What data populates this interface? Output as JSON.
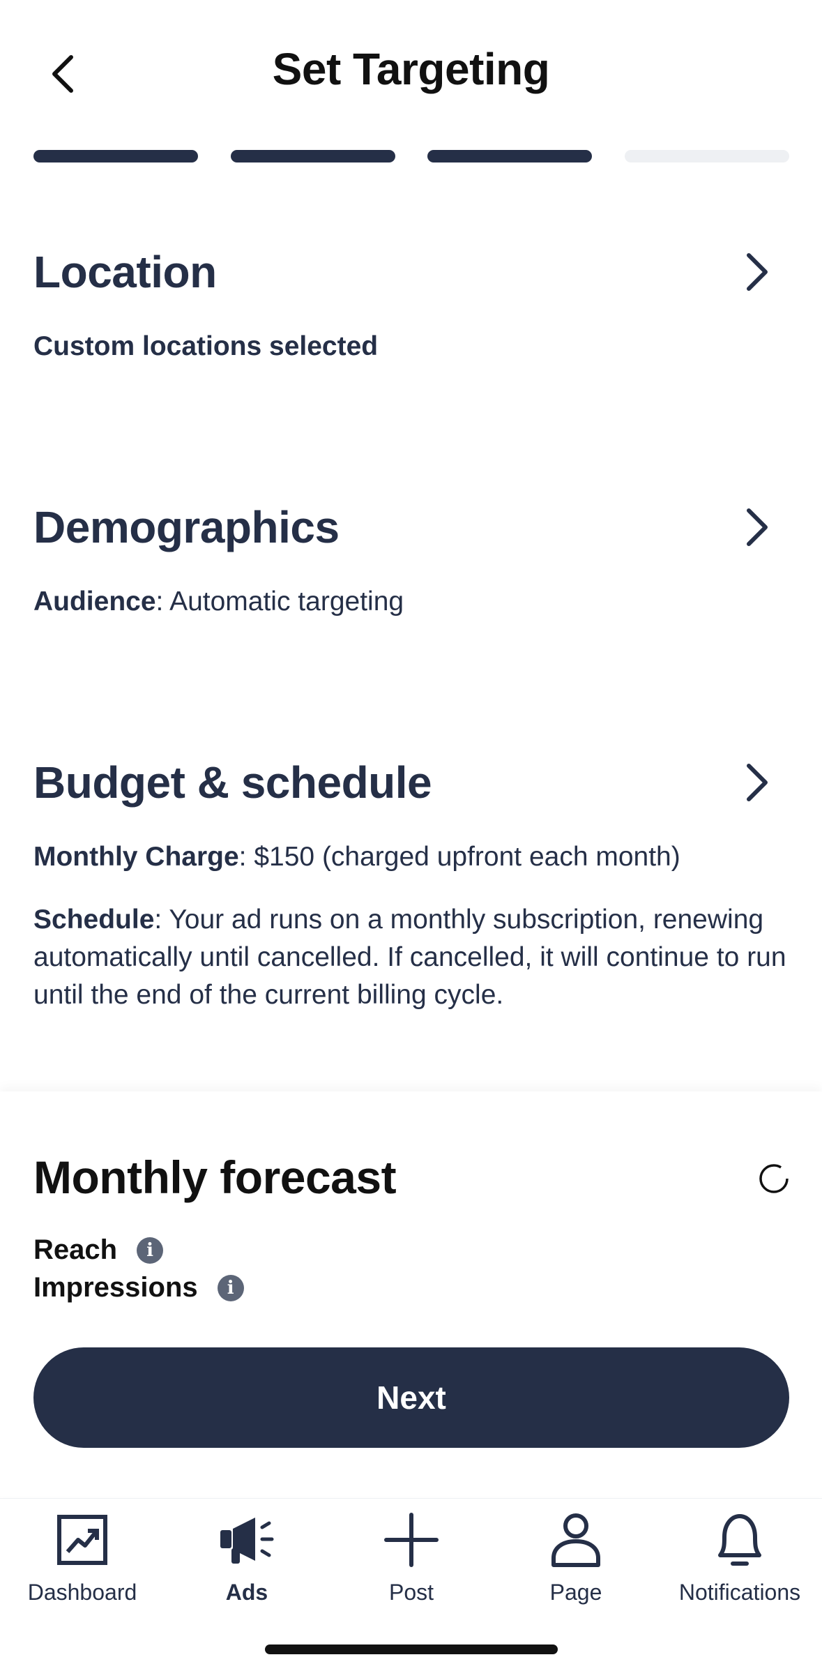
{
  "header": {
    "title": "Set Targeting"
  },
  "progress": {
    "steps_total": 4,
    "steps_completed": 3
  },
  "sections": {
    "location": {
      "title": "Location",
      "value": "Custom locations selected"
    },
    "demographics": {
      "title": "Demographics",
      "audience_label": "Audience",
      "audience_value": ": Automatic targeting"
    },
    "budget": {
      "title": "Budget & schedule",
      "charge_label": "Monthly Charge",
      "charge_value": ": $150 (charged upfront each month)",
      "schedule_label": "Schedule",
      "schedule_value": ": Your ad runs on a monthly subscription, renewing automatically until cancelled. If cancelled, it will continue to run until the end of the current billing cycle."
    }
  },
  "forecast": {
    "title": "Monthly forecast",
    "reach_label": "Reach",
    "impressions_label": "Impressions",
    "info_glyph": "i"
  },
  "next_label": "Next",
  "tabs": [
    {
      "label": "Dashboard",
      "icon": "chart-trend-icon"
    },
    {
      "label": "Ads",
      "icon": "megaphone-icon",
      "active": true
    },
    {
      "label": "Post",
      "icon": "plus-icon"
    },
    {
      "label": "Page",
      "icon": "person-icon"
    },
    {
      "label": "Notifications",
      "icon": "bell-icon"
    }
  ],
  "colors": {
    "primary": "#252f47",
    "inactive_segment": "#eef0f3",
    "info_icon": "#5c6577"
  }
}
